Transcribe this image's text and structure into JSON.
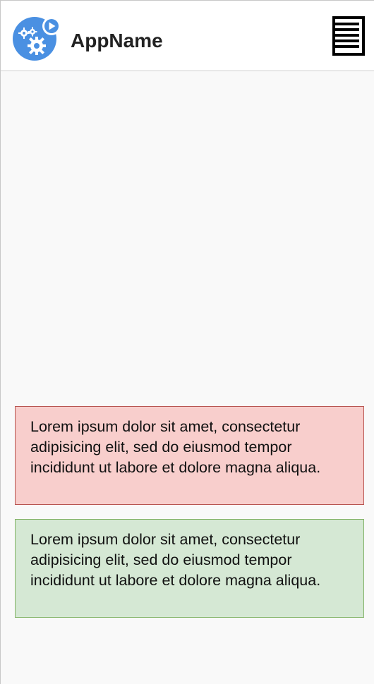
{
  "header": {
    "app_name": "AppName",
    "logo_icon": "gears-play-icon",
    "menu_icon": "menu-list-icon",
    "logo_color": "#4a90e2"
  },
  "alerts": [
    {
      "text": "Lorem ipsum dolor sit amet, consectetur adipisicing elit, sed do eiusmod tempor incididunt ut labore et dolore magna aliqua.",
      "background": "#f8cecc",
      "border": "#b85450"
    },
    {
      "text": "Lorem ipsum dolor sit amet, consectetur adipisicing elit, sed do eiusmod tempor incididunt ut labore et dolore magna aliqua.",
      "background": "#d5e8d4",
      "border": "#82b366"
    }
  ]
}
